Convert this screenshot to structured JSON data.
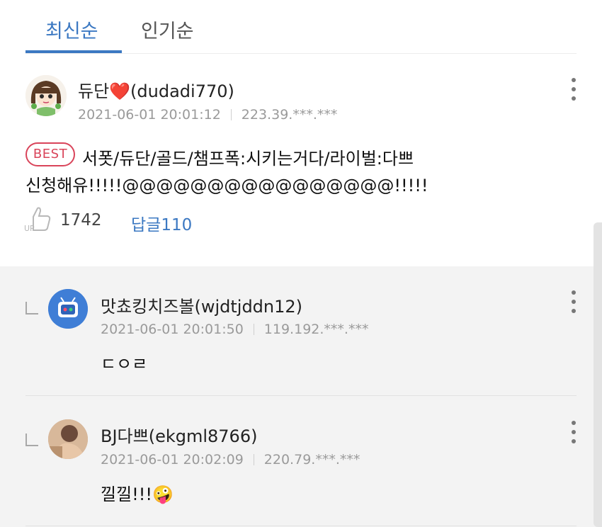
{
  "tabs": [
    {
      "label": "최신순",
      "active": true
    },
    {
      "label": "인기순",
      "active": false
    }
  ],
  "main_comment": {
    "author": "듀단❤️(dudadi770)",
    "date": "2021-06-01 20:01:12",
    "ip": "223.39.***.***",
    "badge": "BEST",
    "text_line1": "서폿/듀단/골드/챔프폭:시키는거다/라이벌:다쁘",
    "text_line2": "신청해유!!!!!@@@@@@@@@@@@@@@@!!!!!",
    "like_count": "1742",
    "reply_label": "답글110"
  },
  "replies": [
    {
      "author": "맛쵸킹치즈볼(wjdtjddn12)",
      "date": "2021-06-01 20:01:50",
      "ip": "119.192.***.***",
      "text": "ㄷㅇㄹ"
    },
    {
      "author": "BJ다쁘(ekgml8766)",
      "date": "2021-06-01 20:02:09",
      "ip": "220.79.***.***",
      "text": "낄낄!!!🤪"
    }
  ],
  "colors": {
    "accent": "#3b78c2",
    "best": "#d9445a",
    "reply_bg": "#f3f3f3"
  }
}
